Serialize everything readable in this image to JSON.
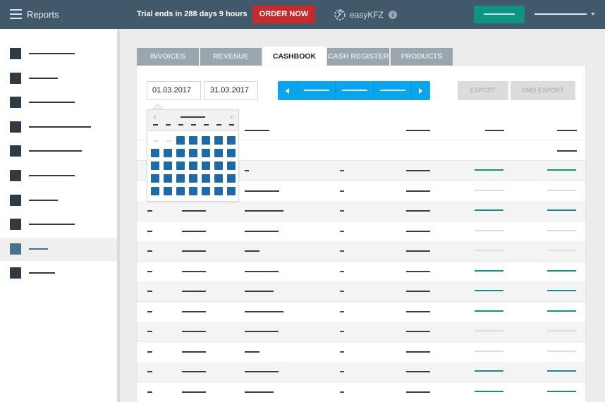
{
  "topbar": {
    "menu_icon": "hamburger-menu-icon",
    "title": "Reports",
    "trial_text": "Trial ends in 288 days 9 hours",
    "order_button": "ORDER NOW",
    "brand_icon": "wrench-gear-icon",
    "brand_name": "easyKFZ",
    "info_icon": "i",
    "colors": {
      "bar": "#42596b",
      "order": "#c62a2a",
      "primary": "#0f9483"
    }
  },
  "sidebar": {
    "items": [
      {
        "label": "",
        "active": false
      },
      {
        "label": "",
        "active": false
      },
      {
        "label": "",
        "active": false
      },
      {
        "label": "",
        "active": false
      },
      {
        "label": "",
        "active": false
      },
      {
        "label": "",
        "active": false
      },
      {
        "label": "",
        "active": false
      },
      {
        "label": "",
        "active": false
      },
      {
        "label": "",
        "active": true
      },
      {
        "label": "",
        "active": false
      }
    ]
  },
  "tabs": [
    {
      "label": "INVOICES",
      "active": false
    },
    {
      "label": "REVENUE",
      "active": false
    },
    {
      "label": "CASHBOOK",
      "active": true
    },
    {
      "label": "CASH REGISTER",
      "active": false
    },
    {
      "label": "PRODUCTS",
      "active": false
    }
  ],
  "filters": {
    "date_from": "01.03.2017",
    "date_to": "31.03.2017",
    "period_prev_icon": "caret-left-icon",
    "period_next_icon": "caret-right-icon",
    "export_label": "EXPORT",
    "bmd_export_label": "BMD EXPORT"
  },
  "datepicker": {
    "open": true,
    "leading_empty_days": 2,
    "days_shown": 33
  },
  "table": {
    "row_status": [
      "green",
      "light",
      "light",
      "green",
      "green",
      "green",
      "light",
      "light",
      "green",
      "green",
      "green"
    ]
  }
}
